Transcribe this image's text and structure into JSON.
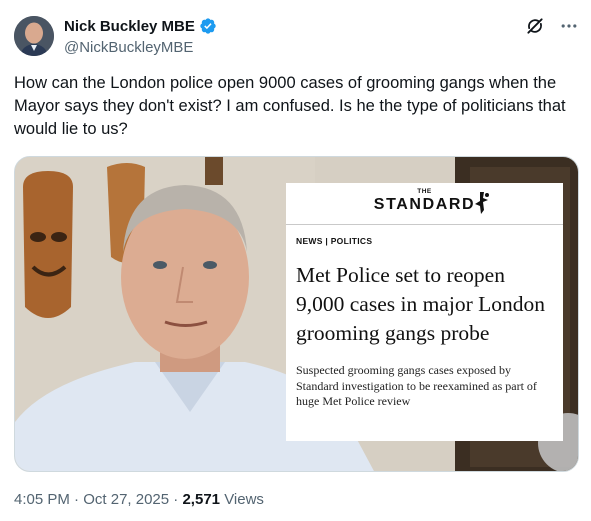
{
  "author": {
    "display_name": "Nick Buckley MBE",
    "handle": "@NickBuckleyMBE",
    "verified_color": "#1d9bf0"
  },
  "header_icons": [
    "grok-icon",
    "more-icon"
  ],
  "tweet": {
    "text": "How can the London police open 9000 cases of grooming gangs when the Mayor says they don't exist? I am confused. Is he the type of politicians that would lie to us?"
  },
  "media": {
    "card": {
      "masthead_the": "THE",
      "masthead_name": "STANDARD",
      "section": "NEWS | POLITICS",
      "headline": "Met Police set to reopen 9,000 cases in major London grooming gangs probe",
      "dek": "Suspected grooming gangs cases exposed by Standard investigation to be reexamined as part of huge Met Police review"
    }
  },
  "footer": {
    "time": "4:05 PM",
    "separator1": "·",
    "date": "Oct 27, 2025",
    "separator2": "·",
    "views_count": "2,571",
    "views_label": "Views"
  }
}
